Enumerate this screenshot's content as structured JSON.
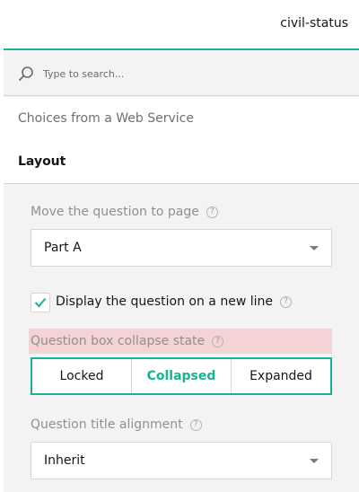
{
  "header": {
    "title": "civil-status"
  },
  "search": {
    "placeholder": "Type to search..."
  },
  "categories": [
    {
      "label": "Choices from a Web Service"
    },
    {
      "label": "Layout"
    }
  ],
  "layout": {
    "move_to_page": {
      "label": "Move the question to page",
      "value": "Part A"
    },
    "new_line": {
      "label": "Display the question on a new line",
      "checked": true
    },
    "collapse_state": {
      "label": "Question box collapse state",
      "options": [
        "Locked",
        "Collapsed",
        "Expanded"
      ],
      "selected": "Collapsed"
    },
    "title_alignment": {
      "label": "Question title alignment",
      "value": "Inherit"
    }
  },
  "colors": {
    "accent": "#19b394",
    "highlight": "#f4d3d4"
  },
  "icons": {
    "search": "search-icon",
    "help": "help-circle-icon",
    "check": "check-icon",
    "arrow": "chevron-down-icon"
  }
}
